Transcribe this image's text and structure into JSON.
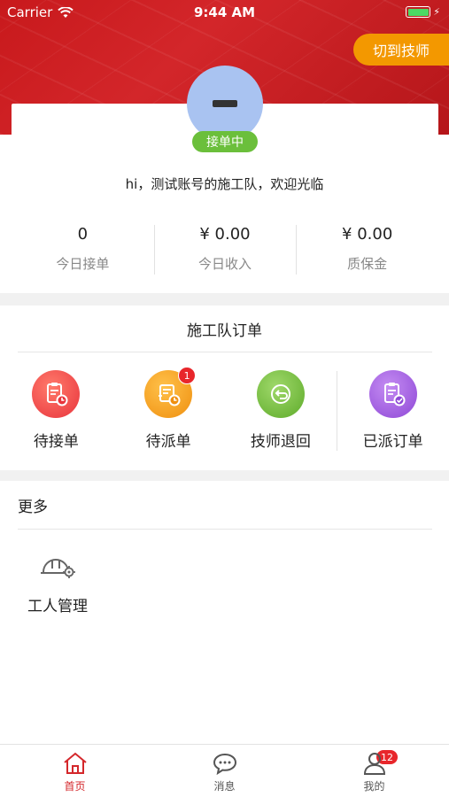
{
  "status_bar": {
    "carrier": "Carrier",
    "time": "9:44 AM"
  },
  "header": {
    "switch_label": "切到技师"
  },
  "profile": {
    "status": "接单中",
    "welcome": "hi，测试账号的施工队，欢迎光临",
    "stats": [
      {
        "value": "0",
        "label": "今日接单"
      },
      {
        "value": "¥ 0.00",
        "label": "今日收入"
      },
      {
        "value": "¥ 0.00",
        "label": "质保金"
      }
    ]
  },
  "orders": {
    "title": "施工队订单",
    "items": [
      {
        "label": "待接单",
        "icon": "clipboard-clock-icon",
        "color": "#f0484b"
      },
      {
        "label": "待派单",
        "icon": "list-clock-icon",
        "color": "#f3a020",
        "badge": "1"
      },
      {
        "label": "技师退回",
        "icon": "return-arrow-icon",
        "color": "#7bc43f"
      },
      {
        "label": "已派订单",
        "icon": "clipboard-check-icon",
        "color": "#a15ee0"
      }
    ]
  },
  "more": {
    "title": "更多",
    "items": [
      {
        "label": "工人管理",
        "icon": "hardhat-gear-icon"
      }
    ]
  },
  "tabbar": {
    "tabs": [
      {
        "label": "首页",
        "icon": "home-icon",
        "active": true
      },
      {
        "label": "消息",
        "icon": "chat-icon",
        "badge": "12"
      },
      {
        "label": "我的",
        "icon": "user-icon"
      }
    ]
  },
  "colors": {
    "primary": "#d4272b",
    "orange": "#f39800",
    "green": "#6bbf3b"
  }
}
